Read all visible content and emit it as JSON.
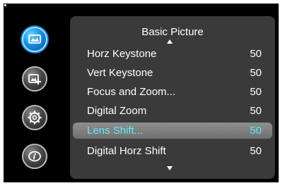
{
  "menu": {
    "title": "Basic Picture",
    "items": [
      {
        "label": "Horz Keystone",
        "value": "50"
      },
      {
        "label": "Vert Keystone",
        "value": "50"
      },
      {
        "label": "Focus and Zoom...",
        "value": "50"
      },
      {
        "label": "Digital Zoom",
        "value": "50"
      },
      {
        "label": "Lens Shift...",
        "value": "50",
        "selected": true
      },
      {
        "label": "Digital Horz Shift",
        "value": "50"
      }
    ]
  },
  "sidebar": {
    "icons": [
      "picture-icon",
      "advanced-picture-icon",
      "settings-icon",
      "information-icon"
    ],
    "active": "picture-icon"
  },
  "colors": {
    "highlight_text": "#62e6ff",
    "panel": "#3a3a3a",
    "active_icon": "#1f8ee2"
  }
}
